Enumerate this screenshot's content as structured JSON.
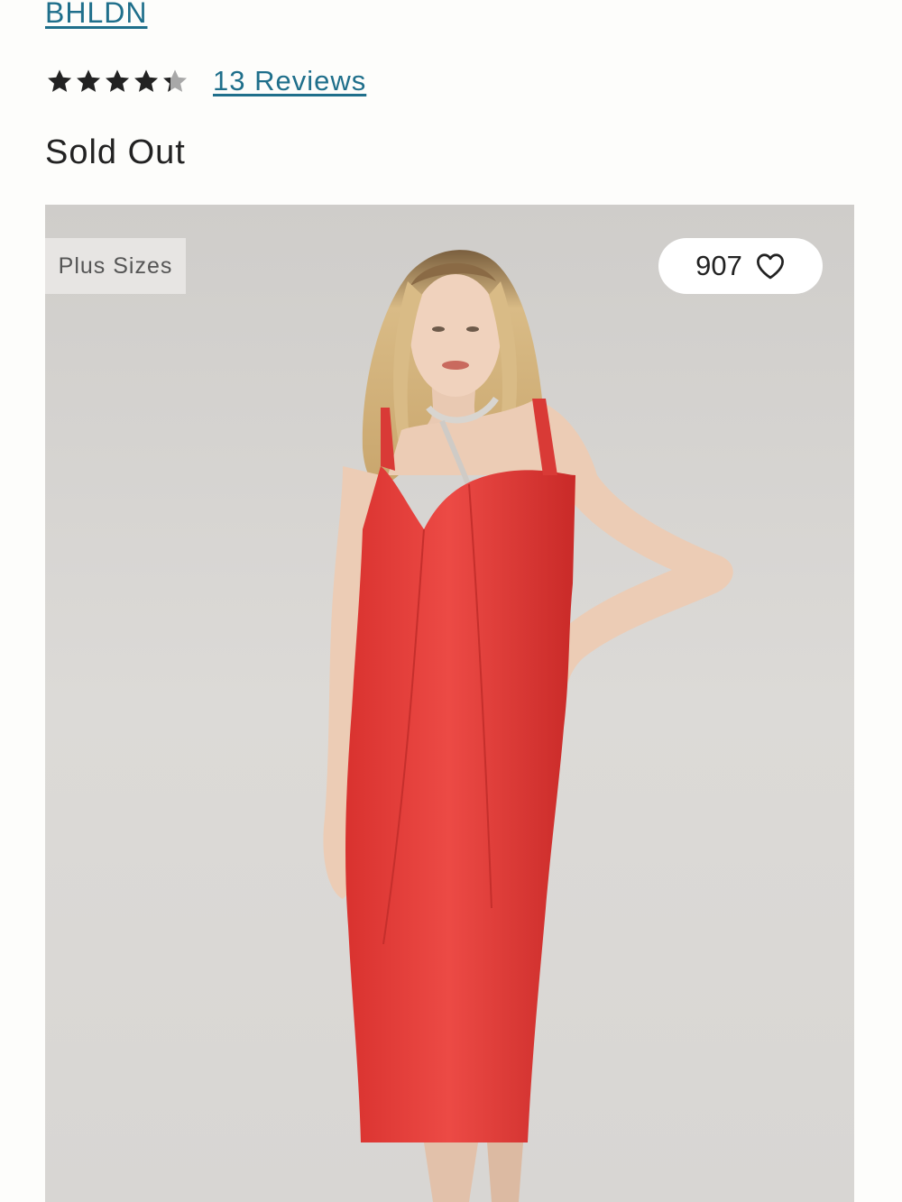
{
  "brand": {
    "name": "BHLDN"
  },
  "rating": {
    "value": 4.3,
    "max": 5,
    "reviews_label": "13 Reviews",
    "filled_color": "#222222",
    "empty_color": "#a8a8a8"
  },
  "availability": {
    "status": "Sold Out"
  },
  "product_image": {
    "badge": "Plus Sizes",
    "favorites_count": "907",
    "dress_color": "#e8403f",
    "background_color": "#d6d4d1"
  }
}
